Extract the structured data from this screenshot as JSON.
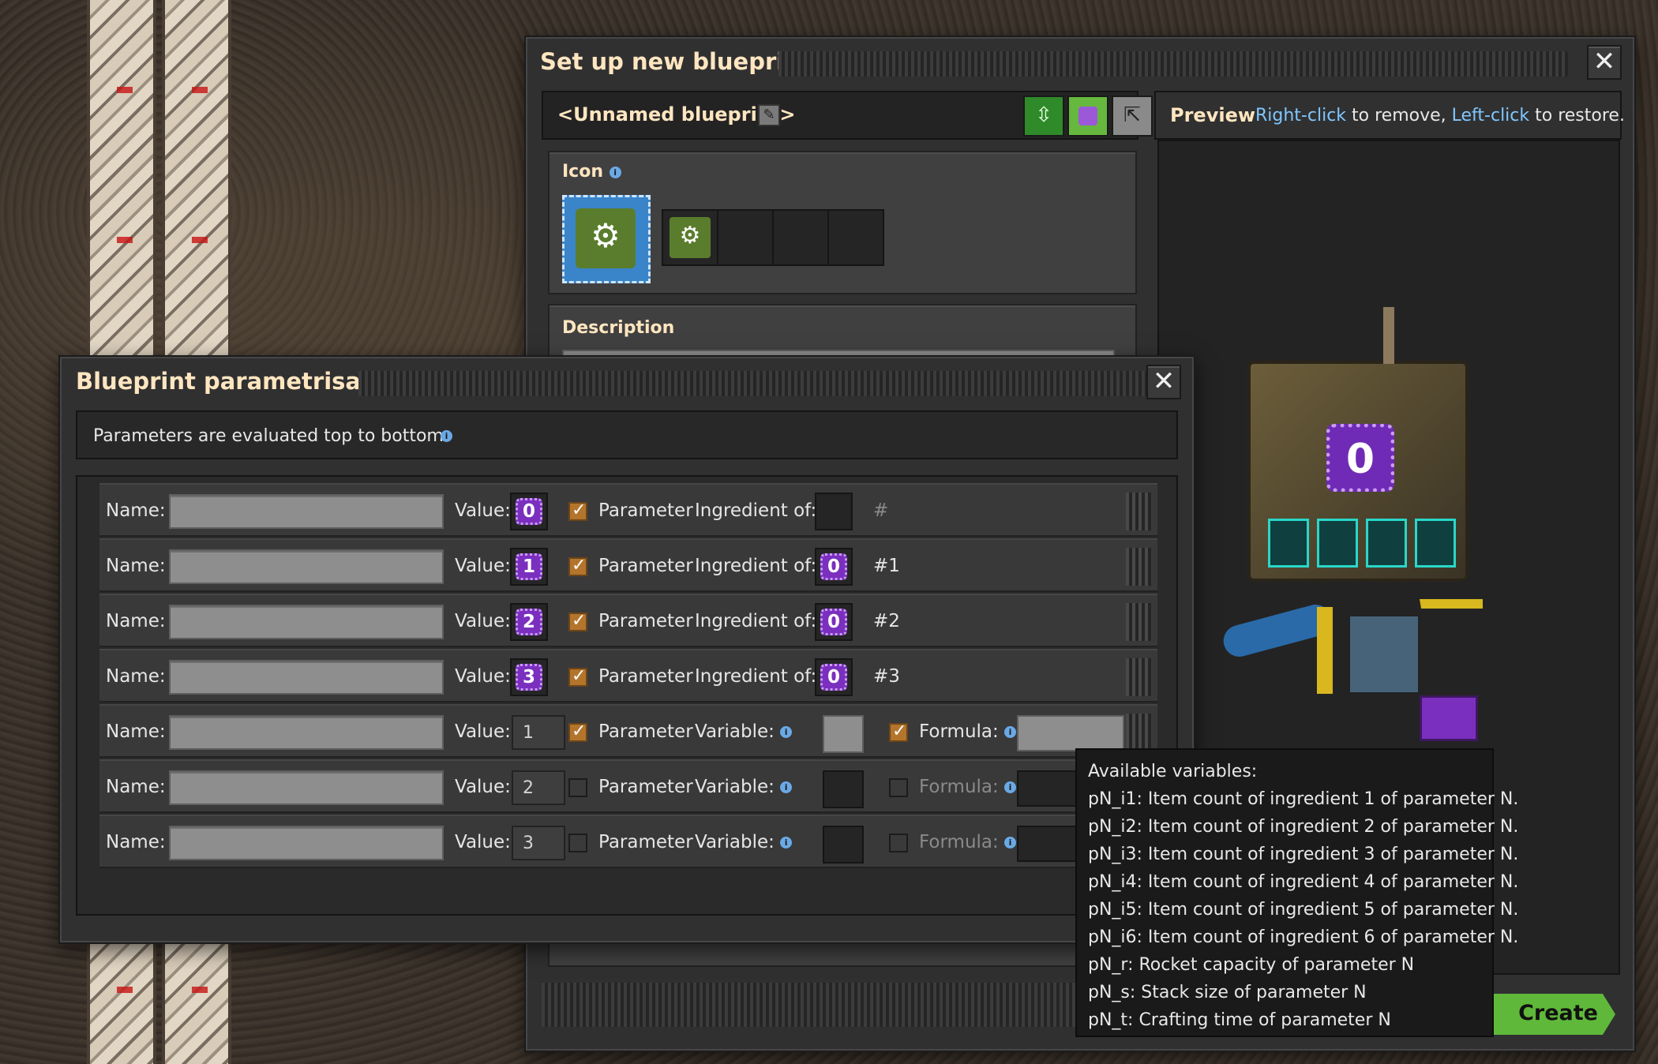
{
  "blueprint_window": {
    "title": "Set up new blueprint",
    "name": "<Unnamed blueprint>",
    "icon_label": "Icon",
    "description_label": "Description",
    "preview_label": "Preview",
    "preview_hint_part1": "Right-click",
    "preview_hint_part2": " to remove, ",
    "preview_hint_part3": "Left-click",
    "preview_hint_part4": " to restore.",
    "preview_signal_value": "0",
    "create_button_label": "Create blueprint",
    "close_label": "✕"
  },
  "param_window": {
    "title": "Blueprint parametrisation",
    "close_label": "✕",
    "info_text": "Parameters are evaluated top to bottom.",
    "labels": {
      "name": "Name:",
      "value": "Value:",
      "parameter": "Parameter",
      "ingredient_of": "Ingredient of:",
      "variable": "Variable:",
      "formula": "Formula:"
    },
    "signal_rows": [
      {
        "value": "0",
        "parameter_checked": true,
        "ingredient_value": "",
        "ref": "#"
      },
      {
        "value": "1",
        "parameter_checked": true,
        "ingredient_value": "0",
        "ref": "#1"
      },
      {
        "value": "2",
        "parameter_checked": true,
        "ingredient_value": "0",
        "ref": "#2"
      },
      {
        "value": "3",
        "parameter_checked": true,
        "ingredient_value": "0",
        "ref": "#3"
      }
    ],
    "number_rows": [
      {
        "value": "1",
        "parameter_checked": true,
        "formula_checked": true
      },
      {
        "value": "2",
        "parameter_checked": false,
        "formula_checked": false
      },
      {
        "value": "3",
        "parameter_checked": false,
        "formula_checked": false
      }
    ]
  },
  "tooltip": {
    "lines": [
      "Available variables:",
      "pN_i1: Item count of ingredient 1 of parameter N.",
      "pN_i2: Item count of ingredient 2 of parameter N.",
      "pN_i3: Item count of ingredient 3 of parameter N.",
      "pN_i4: Item count of ingredient 4 of parameter N.",
      "pN_i5: Item count of ingredient 5 of parameter N.",
      "pN_i6: Item count of ingredient 6 of parameter N.",
      "pN_r: Rocket capacity of parameter N",
      "pN_s: Stack size of parameter N",
      "pN_t: Crafting time of parameter N"
    ]
  },
  "colors": {
    "title": "#ffe6c0",
    "link": "#7fc7ff",
    "signal_purple": "#7a2fbf",
    "checkbox_orange": "#b3752c",
    "create_green": "#5fb83a"
  }
}
